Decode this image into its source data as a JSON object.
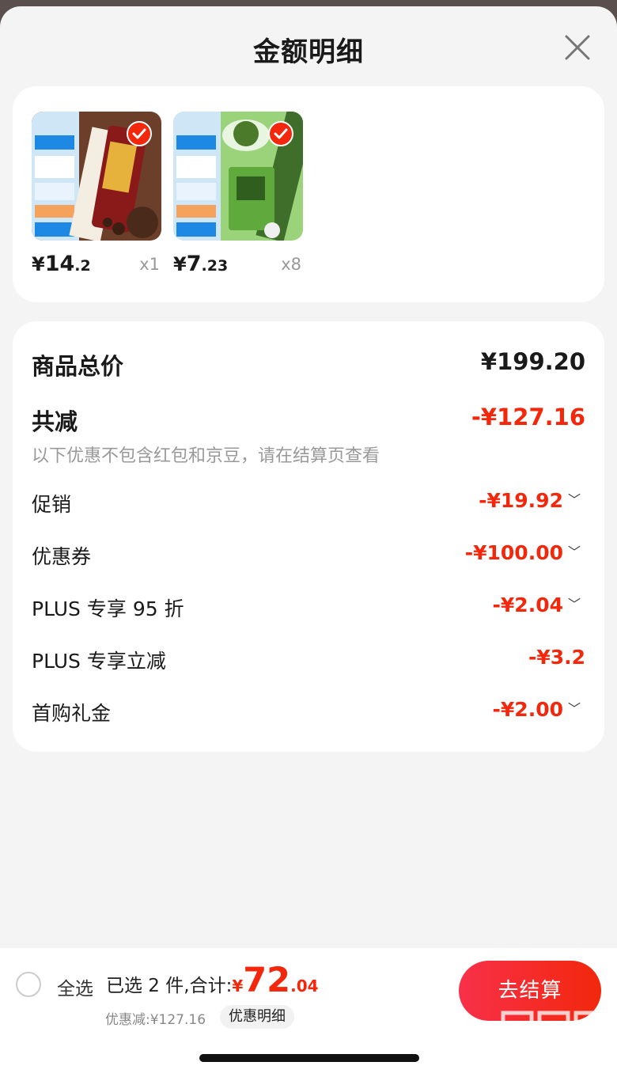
{
  "header": {
    "title": "金额明细"
  },
  "products": [
    {
      "yuan": "¥",
      "price_int": "14",
      "price_dec": ".2",
      "qty": "x1",
      "image": "coffee-ice-cream-bar",
      "selected": true
    },
    {
      "yuan": "¥",
      "price_int": "7",
      "price_dec": ".23",
      "qty": "x8",
      "image": "mung-bean-ice-cream-bar",
      "selected": true
    }
  ],
  "summary": {
    "total_label": "商品总价",
    "total_value": "¥199.20",
    "reduce_label": "共减",
    "reduce_value": "-¥127.16",
    "note": "以下优惠不包含红包和京豆，请在结算页查看",
    "items": [
      {
        "label": "促销",
        "value": "-¥19.92",
        "expandable": true
      },
      {
        "label": "优惠券",
        "value": "-¥100.00",
        "expandable": true
      },
      {
        "label": "PLUS 专享 95 折",
        "value": "-¥2.04",
        "expandable": true
      },
      {
        "label": "PLUS 专享立减",
        "value": "-¥3.2",
        "expandable": false
      },
      {
        "label": "首购礼金",
        "value": "-¥2.00",
        "expandable": true
      }
    ]
  },
  "footer": {
    "select_all": "全选",
    "selected_text": "已选 2 件,合计:",
    "yuan": "¥",
    "total_int": "72",
    "total_dec": ".04",
    "discount_text": "优惠减:¥127.16",
    "detail_button": "优惠明细",
    "checkout_button": "去结算"
  },
  "watermark": {
    "text": "zhizhizhi.com"
  },
  "colors": {
    "accent": "#f2270c",
    "background": "#f4f4f4"
  }
}
